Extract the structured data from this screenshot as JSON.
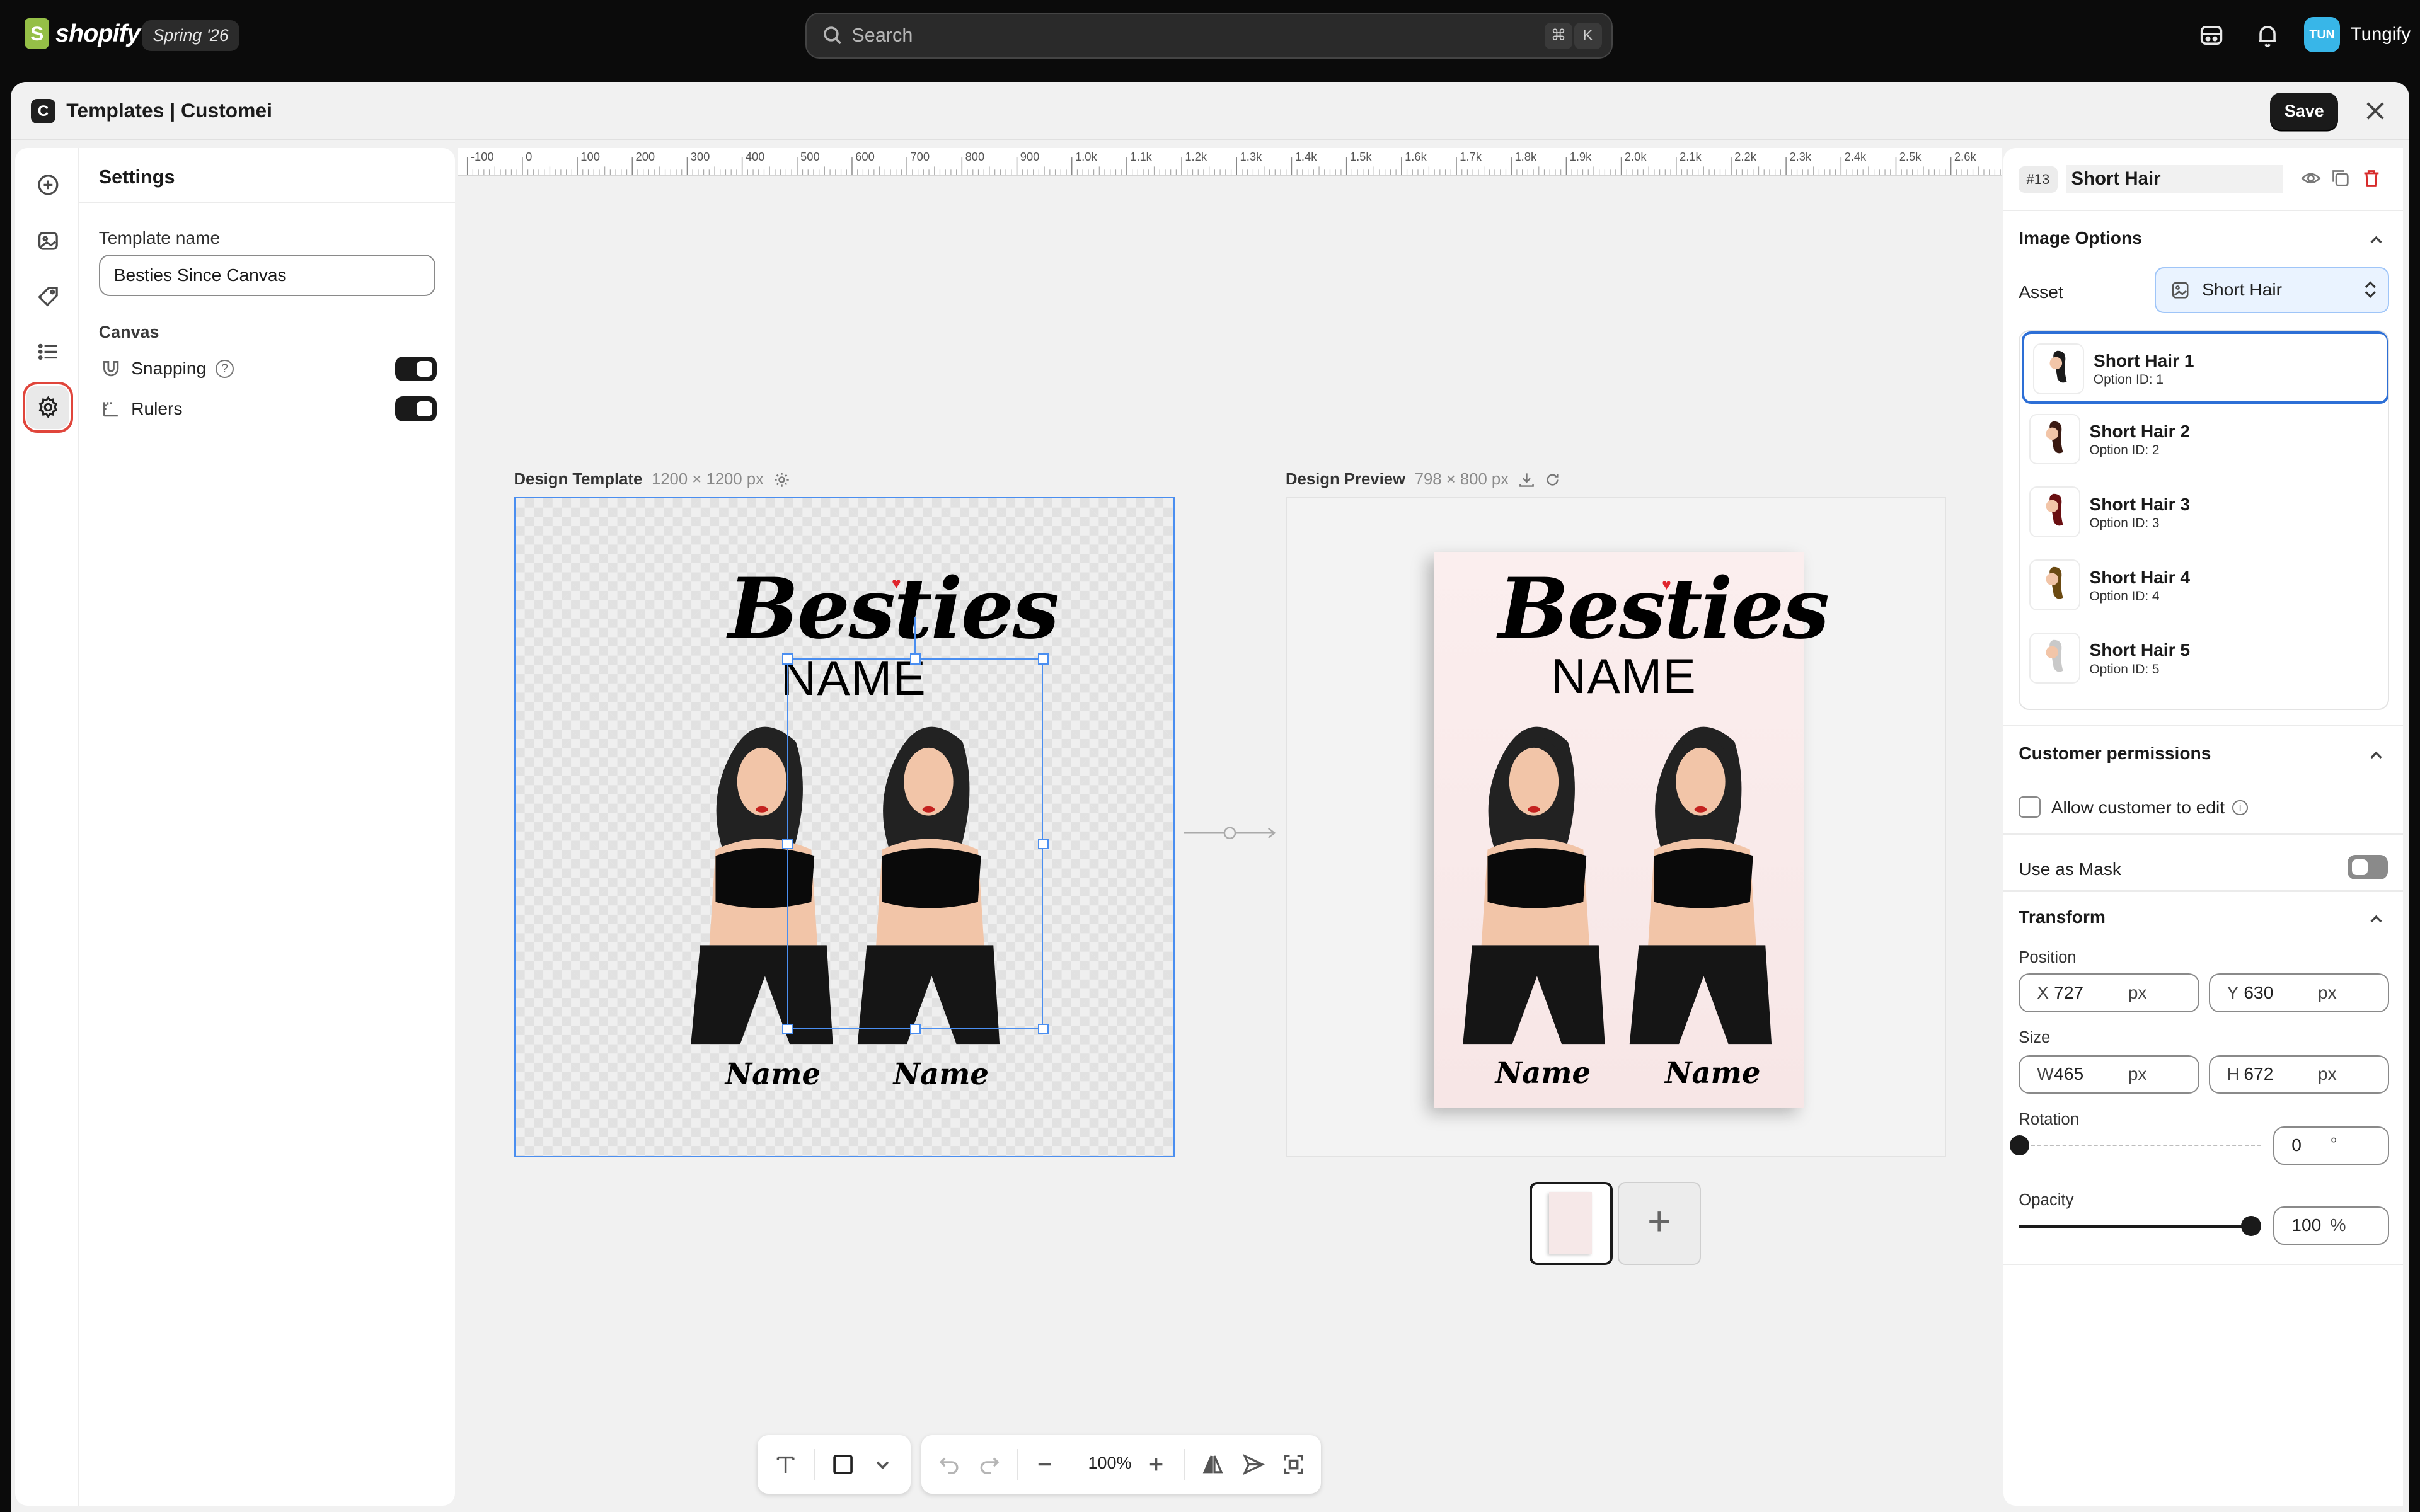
{
  "topbar": {
    "logo_mark": "S",
    "logo_text": "shopify",
    "edition": "Spring '26",
    "search_placeholder": "Search",
    "shortcut_1": "⌘",
    "shortcut_2": "K",
    "user_initials": "TUN",
    "user_name": "Tungify"
  },
  "window": {
    "app_icon": "C",
    "title": "Templates | Customei",
    "save_label": "Save"
  },
  "rail": {
    "items": [
      "add-icon",
      "image-icon",
      "tag-icon",
      "list-icon",
      "gear-icon"
    ],
    "active": "gear-icon"
  },
  "settings": {
    "title": "Settings",
    "template_name_label": "Template name",
    "template_name_value": "Besties Since Canvas",
    "canvas_heading": "Canvas",
    "snapping_label": "Snapping",
    "snapping_on": true,
    "rulers_label": "Rulers",
    "rulers_on": true
  },
  "ruler": {
    "labels": [
      "-100",
      "0",
      "100",
      "200",
      "300",
      "400",
      "500",
      "600",
      "700",
      "800",
      "900",
      "1.0k",
      "1.1k",
      "1.2k",
      "1.3k",
      "1.4k",
      "1.5k",
      "1.6k",
      "1.7k",
      "1.8k",
      "1.9k",
      "2.0k",
      "2.1k",
      "2.2k",
      "2.3k",
      "2.4k",
      "2.5k",
      "2.6k"
    ]
  },
  "canvas": {
    "template_caption": "Design Template",
    "template_dims": "1200 × 1200 px",
    "preview_caption": "Design Preview",
    "preview_dims": "798 × 800 px",
    "art_title": "Besties",
    "art_name": "NAME",
    "art_sig_1": "Name",
    "art_sig_2": "Name",
    "add_page": "+"
  },
  "toolbar": {
    "zoom": "100%"
  },
  "layer": {
    "id": "#13",
    "name": "Short Hair"
  },
  "image_options": {
    "heading": "Image Options",
    "asset_label": "Asset",
    "asset_value": "Short Hair",
    "options": [
      {
        "title": "Short Hair 1",
        "sub": "Option ID: 1",
        "color": "#1b1b1b"
      },
      {
        "title": "Short Hair 2",
        "sub": "Option ID: 2",
        "color": "#3a1a12"
      },
      {
        "title": "Short Hair 3",
        "sub": "Option ID: 3",
        "color": "#6a0f12"
      },
      {
        "title": "Short Hair 4",
        "sub": "Option ID: 4",
        "color": "#6b4a12"
      },
      {
        "title": "Short Hair 5",
        "sub": "Option ID: 5",
        "color": "#c9c9c9"
      }
    ],
    "selected_index": 0
  },
  "permissions": {
    "heading": "Customer permissions",
    "allow_label": "Allow customer to edit",
    "allow_checked": false,
    "mask_label": "Use as Mask",
    "mask_on": false
  },
  "transform": {
    "heading": "Transform",
    "position_label": "Position",
    "x_prefix": "X",
    "x": "727",
    "y_prefix": "Y",
    "y": "630",
    "size_label": "Size",
    "w_prefix": "W",
    "w": "465",
    "h_prefix": "H",
    "h": "672",
    "unit": "px",
    "rotation_label": "Rotation",
    "rotation": "0",
    "rotation_unit": "°",
    "rotation_level": 0,
    "opacity_label": "Opacity",
    "opacity": "100",
    "opacity_unit": "%",
    "opacity_level": 1.0
  },
  "colors": {
    "accent": "#2d6fd6",
    "selection": "#4a8ef0",
    "active_outline": "#e0453b",
    "brand": "#95bf47"
  }
}
